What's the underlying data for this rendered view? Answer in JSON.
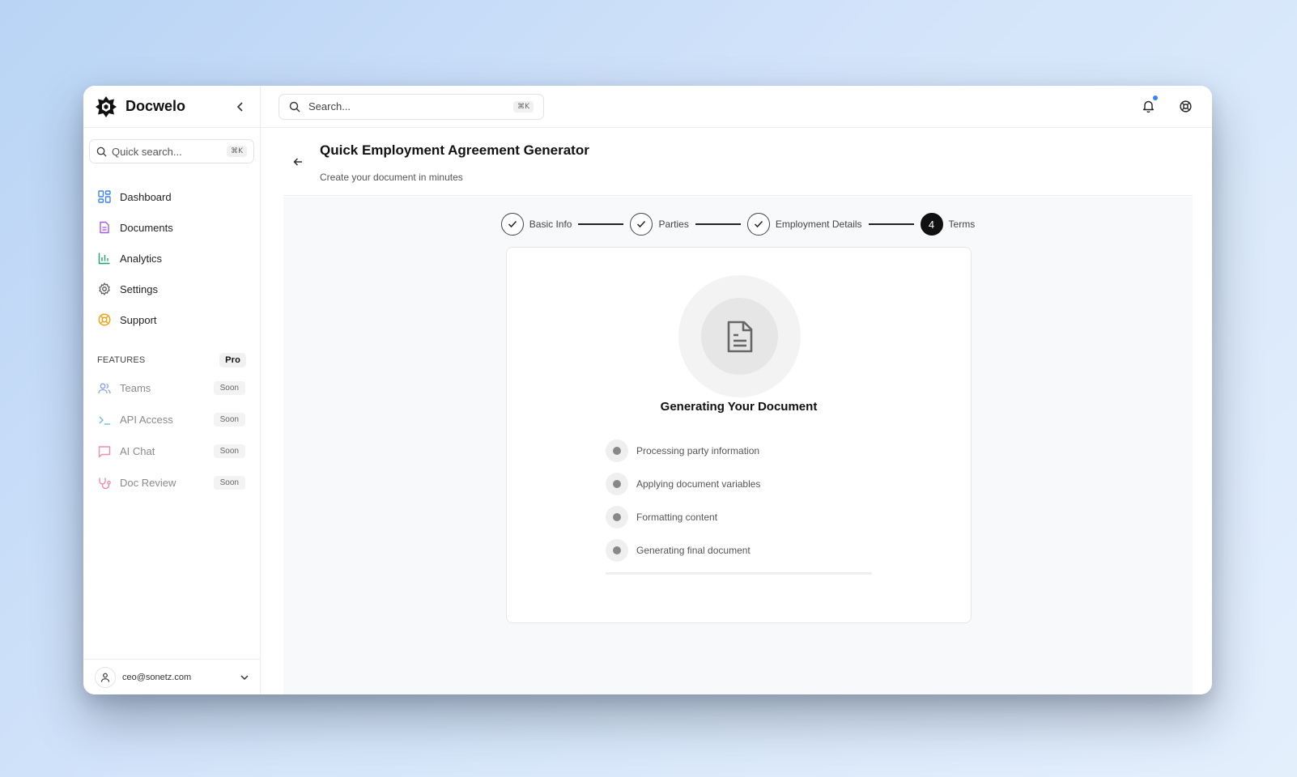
{
  "app": {
    "name": "Docwelo"
  },
  "sidebar": {
    "quick_search": {
      "placeholder": "Quick search...",
      "shortcut": "⌘K"
    },
    "nav": [
      {
        "label": "Dashboard",
        "icon": "dashboard-icon",
        "color": "#3b82f6"
      },
      {
        "label": "Documents",
        "icon": "document-icon",
        "color": "#a855f7"
      },
      {
        "label": "Analytics",
        "icon": "analytics-icon",
        "color": "#22a06b"
      },
      {
        "label": "Settings",
        "icon": "gear-icon",
        "color": "#555555"
      },
      {
        "label": "Support",
        "icon": "lifebuoy-icon",
        "color": "#f59e0b"
      }
    ],
    "features": {
      "heading": "FEATURES",
      "badge": "Pro",
      "items": [
        {
          "label": "Teams",
          "badge": "Soon",
          "icon": "users-icon",
          "color": "#8b9cf0"
        },
        {
          "label": "API Access",
          "badge": "Soon",
          "icon": "terminal-icon",
          "color": "#6cc0d8"
        },
        {
          "label": "AI Chat",
          "badge": "Soon",
          "icon": "chat-icon",
          "color": "#f08ca6"
        },
        {
          "label": "Doc Review",
          "badge": "Soon",
          "icon": "stethoscope-icon",
          "color": "#f08ca6"
        }
      ]
    },
    "user": {
      "email": "ceo@sonetz.com"
    }
  },
  "topbar": {
    "search": {
      "placeholder": "Search...",
      "shortcut": "⌘K"
    },
    "notification_dot_color": "#3b82f6"
  },
  "page": {
    "title": "Quick Employment Agreement Generator",
    "subtitle": "Create your document in minutes"
  },
  "stepper": {
    "steps": [
      {
        "label": "Basic Info",
        "state": "done"
      },
      {
        "label": "Parties",
        "state": "done"
      },
      {
        "label": "Employment Details",
        "state": "done"
      },
      {
        "label": "Terms",
        "state": "active",
        "number": "4"
      }
    ]
  },
  "generation": {
    "title": "Generating Your Document",
    "tasks": [
      "Processing party information",
      "Applying document variables",
      "Formatting content",
      "Generating final document"
    ],
    "progress": 0
  }
}
